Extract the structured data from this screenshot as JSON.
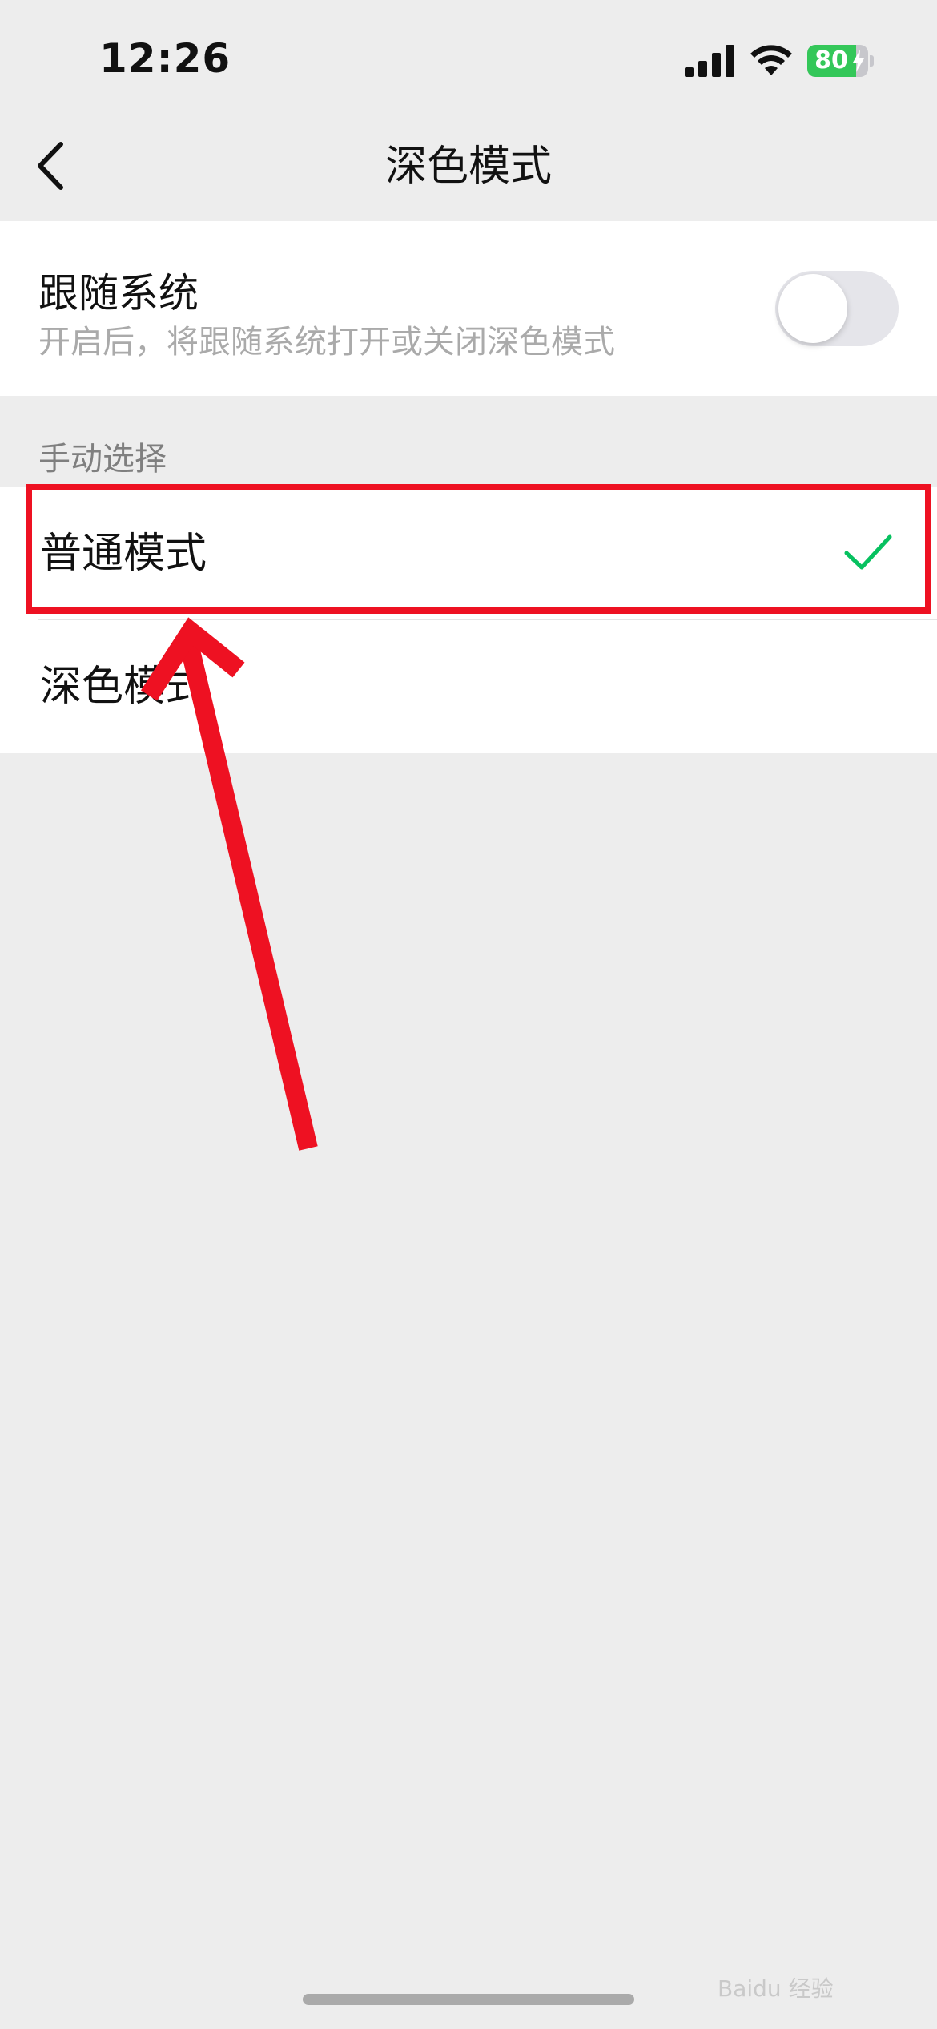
{
  "status_bar": {
    "time": "12:26",
    "battery_level": "80",
    "battery_color": "#34c759",
    "icons": [
      "signal-icon",
      "wifi-icon",
      "battery-icon",
      "charging-bolt-icon"
    ]
  },
  "nav": {
    "title": "深色模式",
    "back_icon": "chevron-left-icon"
  },
  "follow_system": {
    "title": "跟随系统",
    "subtitle": "开启后，将跟随系统打开或关闭深色模式",
    "enabled": false
  },
  "manual": {
    "section_label": "手动选择",
    "options": [
      {
        "label": "普通模式",
        "selected": true
      },
      {
        "label": "深色模式",
        "selected": false
      }
    ],
    "check_color": "#07c160"
  },
  "annotation": {
    "color": "#ee1122",
    "target": "普通模式"
  },
  "watermark": "Baidu 经验"
}
